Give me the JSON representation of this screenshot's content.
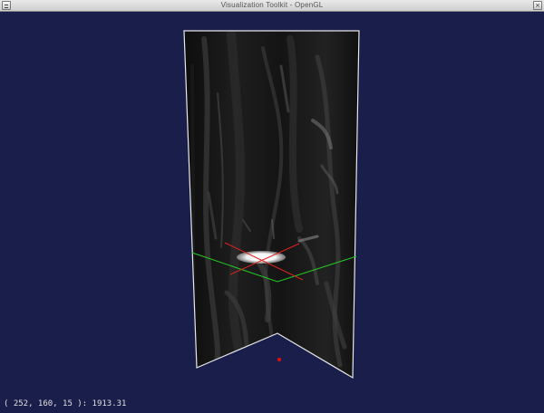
{
  "window": {
    "title": "Visualization Toolkit - OpenGL",
    "close_glyph": "×"
  },
  "viewport": {
    "background_color": "#1a1e4b",
    "coordinate_readout": "( 252, 160, 15 ): 1913.31"
  },
  "scene": {
    "slice_outline_color": "#e8e8e8",
    "axial_plane_color": "#22cc22",
    "sagittal_plane_color": "#dd2222",
    "marker_color": "#e01010"
  }
}
